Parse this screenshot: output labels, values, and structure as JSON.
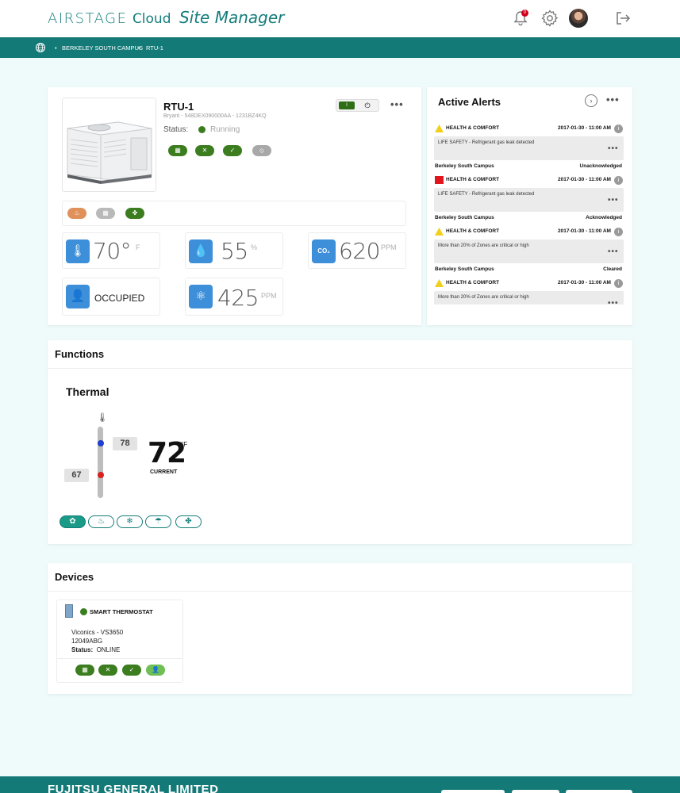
{
  "app": {
    "brand_airstage": "AIRSTAGE",
    "brand_cloud": "Cloud",
    "brand_site_manager": "Site Manager",
    "notification_count": "0",
    "accent_color": "#137a78"
  },
  "breadcrumb": {
    "items": [
      "BERKELEY SOUTH CAMPUS",
      "RTU-1"
    ]
  },
  "unit": {
    "name": "RTU-1",
    "subtitle": "Bryant - 548DEX090000AA - 1231BZ4KQ",
    "status_label": "Status:",
    "status_value": "Running",
    "toggle_on": "I",
    "toggle_power": "⏻",
    "indicators": [
      "grid-icon",
      "fan-icon",
      "leaf-icon",
      "no-icon"
    ],
    "modes": [
      "heat-mode-icon",
      "cool-grid-icon",
      "fan-mode-icon"
    ]
  },
  "stats": {
    "temperature": {
      "value": "70°",
      "unit": "F"
    },
    "humidity": {
      "value": "55",
      "unit": "%"
    },
    "co2": {
      "value": "620",
      "unit": "PPM"
    },
    "occupancy": {
      "value": "OCCUPIED"
    },
    "air_quality": {
      "value": "425",
      "unit": "PPM"
    }
  },
  "alerts": {
    "title": "Active Alerts",
    "items": [
      {
        "severity": "warning",
        "category": "HEALTH & COMFORT",
        "time": "2017-01-30 - 11:00 AM",
        "message": "LIFE SAFETY - Refrigerant gas leak detected",
        "site": "Berkeley South Campus",
        "state": "Unacknowledged"
      },
      {
        "severity": "critical",
        "category": "HEALTH & COMFORT",
        "time": "2017-01-30 - 11:00 AM",
        "message": "LIFE SAFETY - Refrigerant gas leak detected",
        "site": "Berkeley South Campus",
        "state": "Acknowledged"
      },
      {
        "severity": "warning",
        "category": "HEALTH & COMFORT",
        "time": "2017-01-30 - 11:00 AM",
        "message": "More than 20% of Zones are critical or high",
        "site": "Berkeley South Campus",
        "state": "Cleared"
      },
      {
        "severity": "warning",
        "category": "HEALTH & COMFORT",
        "time": "2017-01-30 - 11:00 AM",
        "message": "More than 20% of Zones are critical or high",
        "site": "",
        "state": ""
      }
    ]
  },
  "functions": {
    "title": "Functions",
    "thermal_title": "Thermal",
    "cool_setpoint": "78",
    "heat_setpoint": "67",
    "current_temp": "72",
    "current_unit": "°F",
    "current_label": "CURRENT",
    "modes": [
      "auto-mode-icon",
      "heat-mode-icon",
      "cool-mode-icon",
      "dry-mode-icon",
      "fan-mode-icon"
    ]
  },
  "devices": {
    "title": "Devices",
    "card": {
      "name": "SMART THERMOSTAT",
      "model": "Viconics - VS3650",
      "serial": "12049ABG",
      "status_label": "Status:",
      "status_value": "ONLINE",
      "indicators": [
        "grid-icon",
        "fan-icon",
        "leaf-icon",
        "person-icon"
      ]
    }
  },
  "footer": {
    "company": "FUJITSU GENERAL LIMITED"
  }
}
